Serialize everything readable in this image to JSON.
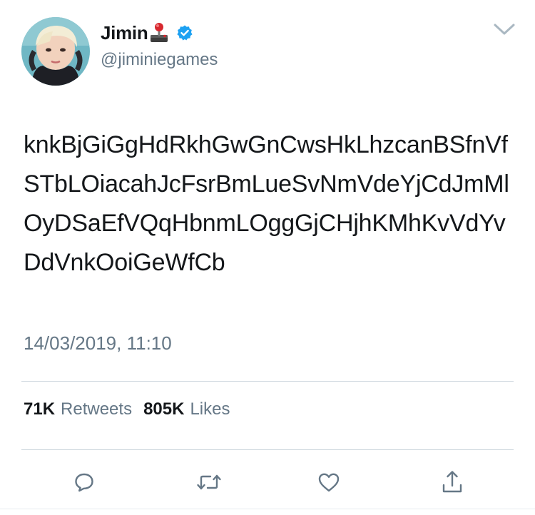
{
  "author": {
    "display_name": "Jimin",
    "handle": "@jiminiegames",
    "name_emoji_icon": "joystick-icon",
    "verified_icon": "verified-badge-icon",
    "avatar": "profile-photo"
  },
  "tweet": {
    "text": "knkBjGiGgHdRkhGwGnCwsHkLhzcanBSfnVfSTbLOiacahJcFsrBmLueSvNmVdeYjCdJmMlOyDSaEfVQqHbnmLOggGjCHjhKMhKvVdYvDdVnkOoiGeWfCb",
    "timestamp": "14/03/2019, 11:10"
  },
  "stats": {
    "retweets_count": "71K",
    "retweets_label": "Retweets",
    "likes_count": "805K",
    "likes_label": "Likes"
  },
  "actions": {
    "reply_icon": "reply-icon",
    "retweet_icon": "retweet-icon",
    "like_icon": "heart-icon",
    "share_icon": "share-icon"
  },
  "colors": {
    "text_primary": "#14171a",
    "text_secondary": "#657786",
    "verified_blue": "#1da1f2",
    "divider": "#ccd6dd",
    "icon_gray": "#657786"
  }
}
